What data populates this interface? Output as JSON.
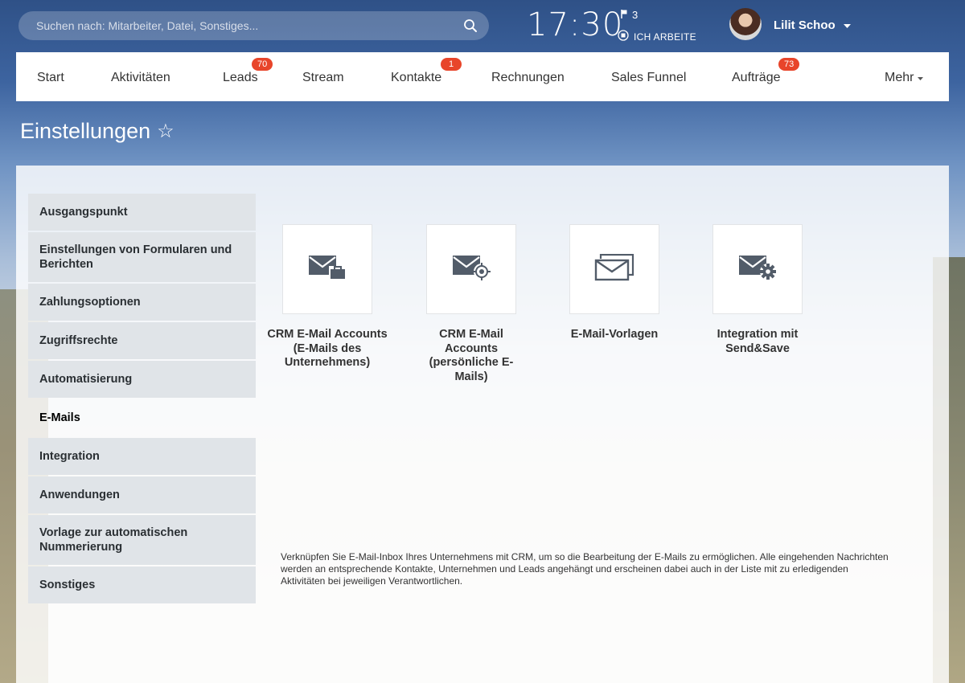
{
  "search": {
    "placeholder": "Suchen nach: Mitarbeiter, Datei, Sonstiges..."
  },
  "clock": {
    "time": "17:30",
    "flag_count": "3",
    "status": "ICH ARBEITE"
  },
  "user": {
    "name": "Lilit Schoo"
  },
  "nav": {
    "items": [
      {
        "label": "Start"
      },
      {
        "label": "Aktivitäten"
      },
      {
        "label": "Leads",
        "badge": "70"
      },
      {
        "label": "Stream"
      },
      {
        "label": "Kontakte",
        "badge": "1"
      },
      {
        "label": "Rechnungen"
      },
      {
        "label": "Sales Funnel"
      },
      {
        "label": "Aufträge",
        "badge": "73"
      },
      {
        "label": "Mehr"
      }
    ]
  },
  "page": {
    "title": "Einstellungen",
    "star": "☆"
  },
  "sidebar": {
    "items": [
      {
        "label": "Ausgangspunkt"
      },
      {
        "label": "Einstellungen von Formularen und Berichten"
      },
      {
        "label": "Zahlungsoptionen"
      },
      {
        "label": "Zugriffsrechte"
      },
      {
        "label": "Automatisierung"
      },
      {
        "label": "E-Mails",
        "active": true
      },
      {
        "label": "Integration"
      },
      {
        "label": "Anwendungen"
      },
      {
        "label": "Vorlage zur automatischen Nummerierung"
      },
      {
        "label": "Sonstiges"
      }
    ]
  },
  "tiles": [
    {
      "label": "CRM E-Mail Accounts (E-Mails des Unternehmens)",
      "icon": "mail-briefcase-icon"
    },
    {
      "label": "CRM E-Mail Accounts (persönliche E-Mails)",
      "icon": "mail-target-icon"
    },
    {
      "label": "E-Mail-Vorlagen",
      "icon": "mail-templates-icon"
    },
    {
      "label": "Integration mit Send&Save",
      "icon": "mail-gear-icon"
    }
  ],
  "description": "Verknüpfen Sie E-Mail-Inbox Ihres Unternehmens mit CRM, um so die Bearbeitung der E-Mails zu ermöglichen. Alle eingehenden Nachrichten werden an entsprechende Kontakte, Unternehmen und Leads angehängt und erscheinen dabei auch in der Liste mit zu erledigenden Aktivitäten bei jeweiligen Verantwortlichen.",
  "colors": {
    "badge": "#e8452a",
    "icon": "#525c69",
    "sidebar_bg": "#e0e4e8"
  }
}
